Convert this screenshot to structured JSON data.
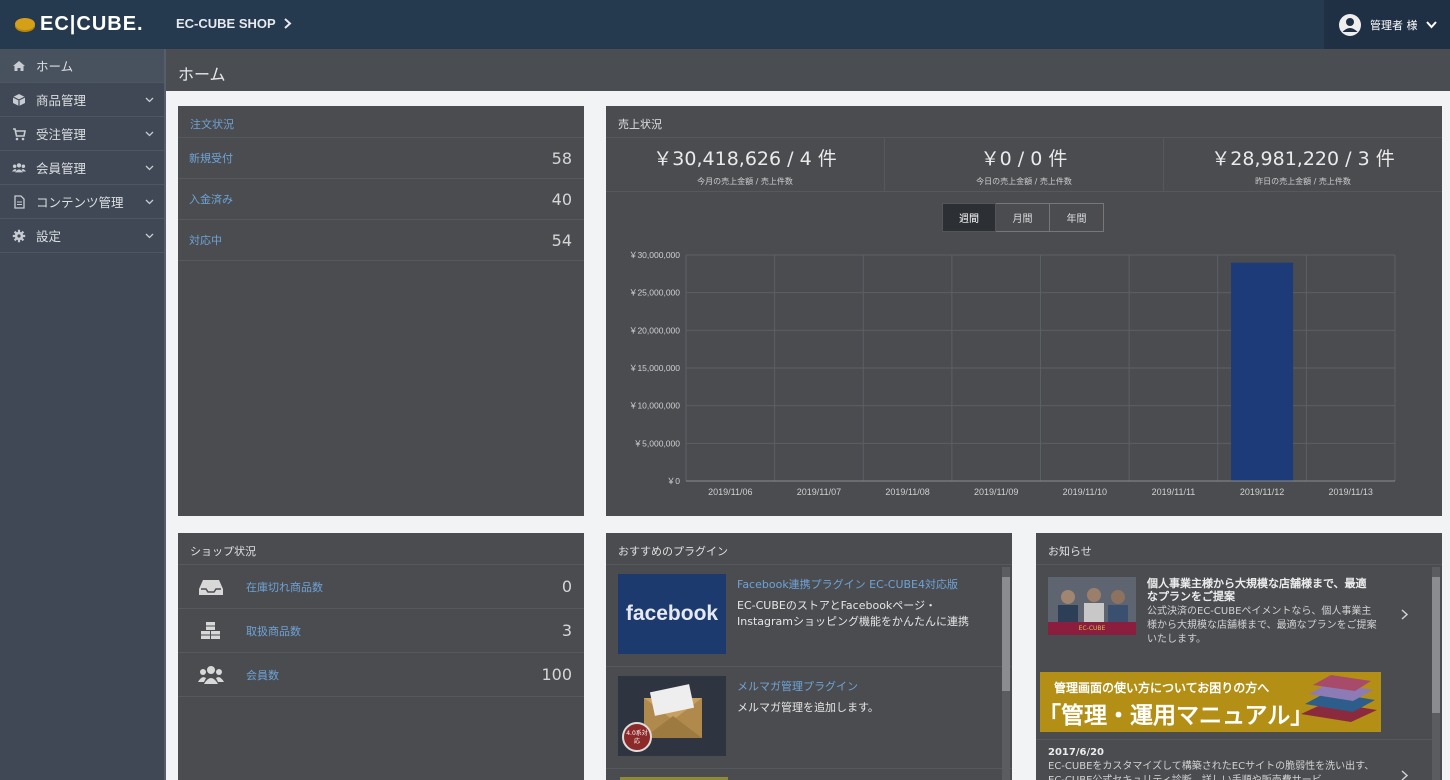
{
  "header": {
    "logo": "EC|CUBE.",
    "shop_name": "EC-CUBE SHOP",
    "user_name": "管理者 様"
  },
  "sidebar": {
    "items": [
      {
        "label": "ホーム",
        "icon": "home-icon"
      },
      {
        "label": "商品管理",
        "icon": "box-icon"
      },
      {
        "label": "受注管理",
        "icon": "cart-icon"
      },
      {
        "label": "会員管理",
        "icon": "users-icon"
      },
      {
        "label": "コンテンツ管理",
        "icon": "document-icon"
      },
      {
        "label": "設定",
        "icon": "gear-icon"
      }
    ]
  },
  "page": {
    "title": "ホーム"
  },
  "order_status": {
    "title": "注文状況",
    "rows": [
      {
        "label": "新規受付",
        "value": "58"
      },
      {
        "label": "入金済み",
        "value": "40"
      },
      {
        "label": "対応中",
        "value": "54"
      }
    ]
  },
  "sales": {
    "title": "売上状況",
    "kpis": [
      {
        "value": "￥30,418,626 / 4 件",
        "label": "今月の売上金額 / 売上件数"
      },
      {
        "value": "￥0 / 0 件",
        "label": "今日の売上金額 / 売上件数"
      },
      {
        "value": "￥28,981,220 / 3 件",
        "label": "昨日の売上金額 / 売上件数"
      }
    ],
    "tabs": [
      {
        "label": "週間",
        "active": true
      },
      {
        "label": "月間",
        "active": false
      },
      {
        "label": "年間",
        "active": false
      }
    ]
  },
  "chart_data": {
    "type": "bar",
    "categories": [
      "2019/11/06",
      "2019/11/07",
      "2019/11/08",
      "2019/11/09",
      "2019/11/10",
      "2019/11/11",
      "2019/11/12",
      "2019/11/13"
    ],
    "values": [
      0,
      0,
      0,
      0,
      0,
      0,
      28981220,
      0
    ],
    "ylim": [
      0,
      30000000
    ],
    "yticks": [
      0,
      5000000,
      10000000,
      15000000,
      20000000,
      25000000,
      30000000
    ],
    "ytick_labels": [
      "￥0",
      "￥5,000,000",
      "￥10,000,000",
      "￥15,000,000",
      "￥20,000,000",
      "￥25,000,000",
      "￥30,000,000"
    ],
    "grid": true,
    "bar_color": "#1c3b78"
  },
  "shop_status": {
    "title": "ショップ状況",
    "rows": [
      {
        "label": "在庫切れ商品数",
        "value": "0",
        "icon": "inbox-icon"
      },
      {
        "label": "取扱商品数",
        "value": "3",
        "icon": "cubes-icon"
      },
      {
        "label": "会員数",
        "value": "100",
        "icon": "users-icon"
      }
    ]
  },
  "plugins": {
    "title": "おすすめのプラグイン",
    "items": [
      {
        "title": "Facebook連携プラグイン EC-CUBE4対応版",
        "desc": "EC-CUBEのストアとFacebookページ・Instagramショッピング機能をかんたんに連携",
        "thumb_text": "facebook"
      },
      {
        "title": "メルマガ管理プラグイン",
        "desc": "メルマガ管理を追加します。",
        "badge": "4.0系対応"
      }
    ]
  },
  "news": {
    "title": "お知らせ",
    "item1_title": "個人事業主様から大規模な店舗様まで、最適なプランをご提案",
    "item1_desc": "公式決済のEC-CUBEペイメントなら、個人事業主様から大規模な店舗様まで、最適なプランをご提案いたします。",
    "item1_thumb_badge": "EC-CUBE",
    "banner_line1": "管理画面の使い方についてお困りの方へ",
    "banner_line2": "「管理・運用マニュアル」",
    "item3_date": "2017/6/20",
    "item3_desc": "EC-CUBEをカスタマイズして構築されたECサイトの脆弱性を洗い出す、EC-CUBE公式セキュリティ診断。詳しい手順や販売費サービ"
  }
}
